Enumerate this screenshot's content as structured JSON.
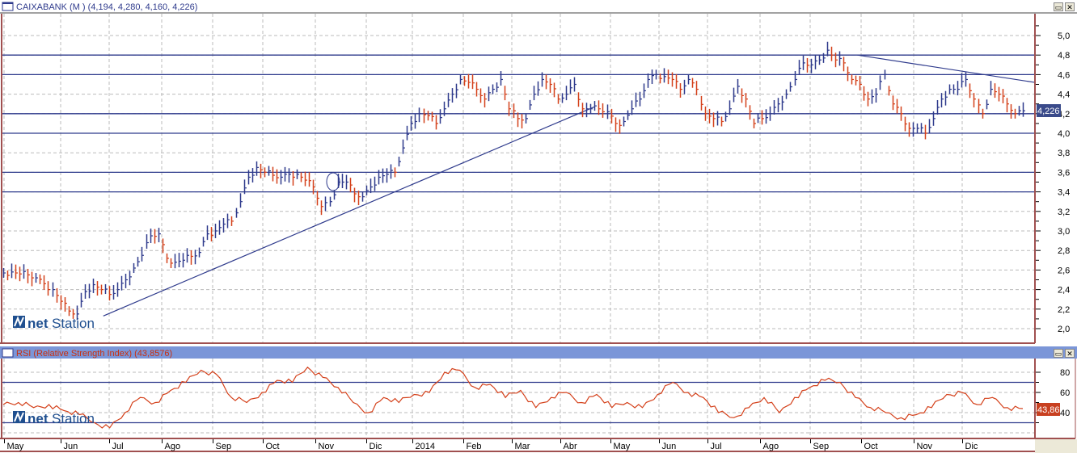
{
  "price_panel": {
    "title": "CAIXABANK (M ) (4,194, 4,280, 4,160, 4,226)",
    "last_value_label": "4,226",
    "logo": "netStation"
  },
  "rsi_panel": {
    "title": "RSI (Relative Strength Index) (43,8576)",
    "last_value_label": "43,86",
    "logo": "netStation"
  },
  "window_buttons": {
    "maximize": "▭",
    "close": "✕"
  },
  "colors": {
    "up": "#2e3a8c",
    "down": "#d4401a",
    "rsi": "#d4401a",
    "level": "#2e3a8c",
    "header_blue": "#7b96d8",
    "frame": "#a05050"
  },
  "chart_data": [
    {
      "type": "ohlc",
      "title": "CAIXABANK (M )",
      "ylim": [
        1.9,
        5.15
      ],
      "yticks": [
        "2,0",
        "2,2",
        "2,4",
        "2,6",
        "2,8",
        "3,0",
        "3,2",
        "3,4",
        "3,6",
        "3,8",
        "4,0",
        "4,2",
        "4,4",
        "4,6",
        "4,8",
        "5,0"
      ],
      "ytick_values": [
        2.0,
        2.2,
        2.4,
        2.6,
        2.8,
        3.0,
        3.2,
        3.4,
        3.6,
        3.8,
        4.0,
        4.2,
        4.4,
        4.6,
        4.8,
        5.0
      ],
      "xticks": [
        "May",
        "Jun",
        "Jul",
        "Ago",
        "Sep",
        "Oct",
        "Nov",
        "Dic",
        "2014",
        "Feb",
        "Mar",
        "Abr",
        "May",
        "Jun",
        "Jul",
        "Ago",
        "Sep",
        "Oct",
        "Nov",
        "Dic"
      ],
      "horizontal_levels": [
        4.8,
        4.6,
        4.2,
        4.0,
        3.6,
        3.4
      ],
      "trendlines": [
        {
          "from": [
            0.097,
            2.13
          ],
          "to": [
            0.573,
            4.27
          ]
        },
        {
          "from": [
            0.828,
            4.8
          ],
          "to": [
            1.0,
            4.52
          ]
        }
      ],
      "close": [
        2.57,
        2.58,
        2.56,
        2.55,
        2.52,
        2.46,
        2.4,
        2.28,
        2.18,
        2.15,
        2.38,
        2.45,
        2.4,
        2.35,
        2.4,
        2.5,
        2.62,
        2.75,
        2.95,
        2.97,
        2.72,
        2.68,
        2.7,
        2.74,
        2.78,
        2.97,
        3.0,
        3.07,
        3.1,
        3.3,
        3.55,
        3.65,
        3.6,
        3.57,
        3.55,
        3.58,
        3.58,
        3.52,
        3.45,
        3.25,
        3.3,
        3.5,
        3.5,
        3.38,
        3.35,
        3.45,
        3.55,
        3.58,
        3.6,
        3.85,
        4.1,
        4.2,
        4.18,
        4.1,
        4.25,
        4.4,
        4.55,
        4.52,
        4.45,
        4.35,
        4.45,
        4.55,
        4.25,
        4.15,
        4.15,
        4.4,
        4.55,
        4.5,
        4.35,
        4.4,
        4.5,
        4.25,
        4.25,
        4.25,
        4.22,
        4.1,
        4.12,
        4.25,
        4.35,
        4.55,
        4.6,
        4.58,
        4.55,
        4.45,
        4.55,
        4.45,
        4.2,
        4.15,
        4.12,
        4.25,
        4.48,
        4.35,
        4.1,
        4.15,
        4.2,
        4.3,
        4.4,
        4.55,
        4.72,
        4.7,
        4.75,
        4.85,
        4.75,
        4.72,
        4.55,
        4.5,
        4.35,
        4.4,
        4.6,
        4.3,
        4.2,
        4.05,
        4.05,
        4.0,
        4.15,
        4.35,
        4.45,
        4.45,
        4.55,
        4.35,
        4.2,
        4.45,
        4.4,
        4.3,
        4.2,
        4.23
      ]
    },
    {
      "type": "line",
      "title": "RSI (Relative Strength Index)",
      "ylim": [
        13,
        93
      ],
      "yticks": [
        "40",
        "60",
        "80"
      ],
      "ytick_values": [
        40,
        60,
        80
      ],
      "horizontal_levels": [
        70,
        30
      ],
      "values": [
        48,
        50,
        45,
        48,
        42,
        38,
        30,
        25,
        40,
        55,
        50,
        62,
        70,
        82,
        78,
        55,
        50,
        60,
        72,
        70,
        85,
        75,
        65,
        50,
        40,
        55,
        50,
        58,
        60,
        80,
        82,
        65,
        68,
        55,
        62,
        45,
        55,
        60,
        50,
        58,
        45,
        50,
        45,
        58,
        70,
        60,
        55,
        40,
        35,
        45,
        55,
        40,
        55,
        65,
        72,
        70,
        55,
        45,
        40,
        35,
        38,
        45,
        58,
        60,
        48,
        55,
        45,
        44
      ]
    }
  ]
}
